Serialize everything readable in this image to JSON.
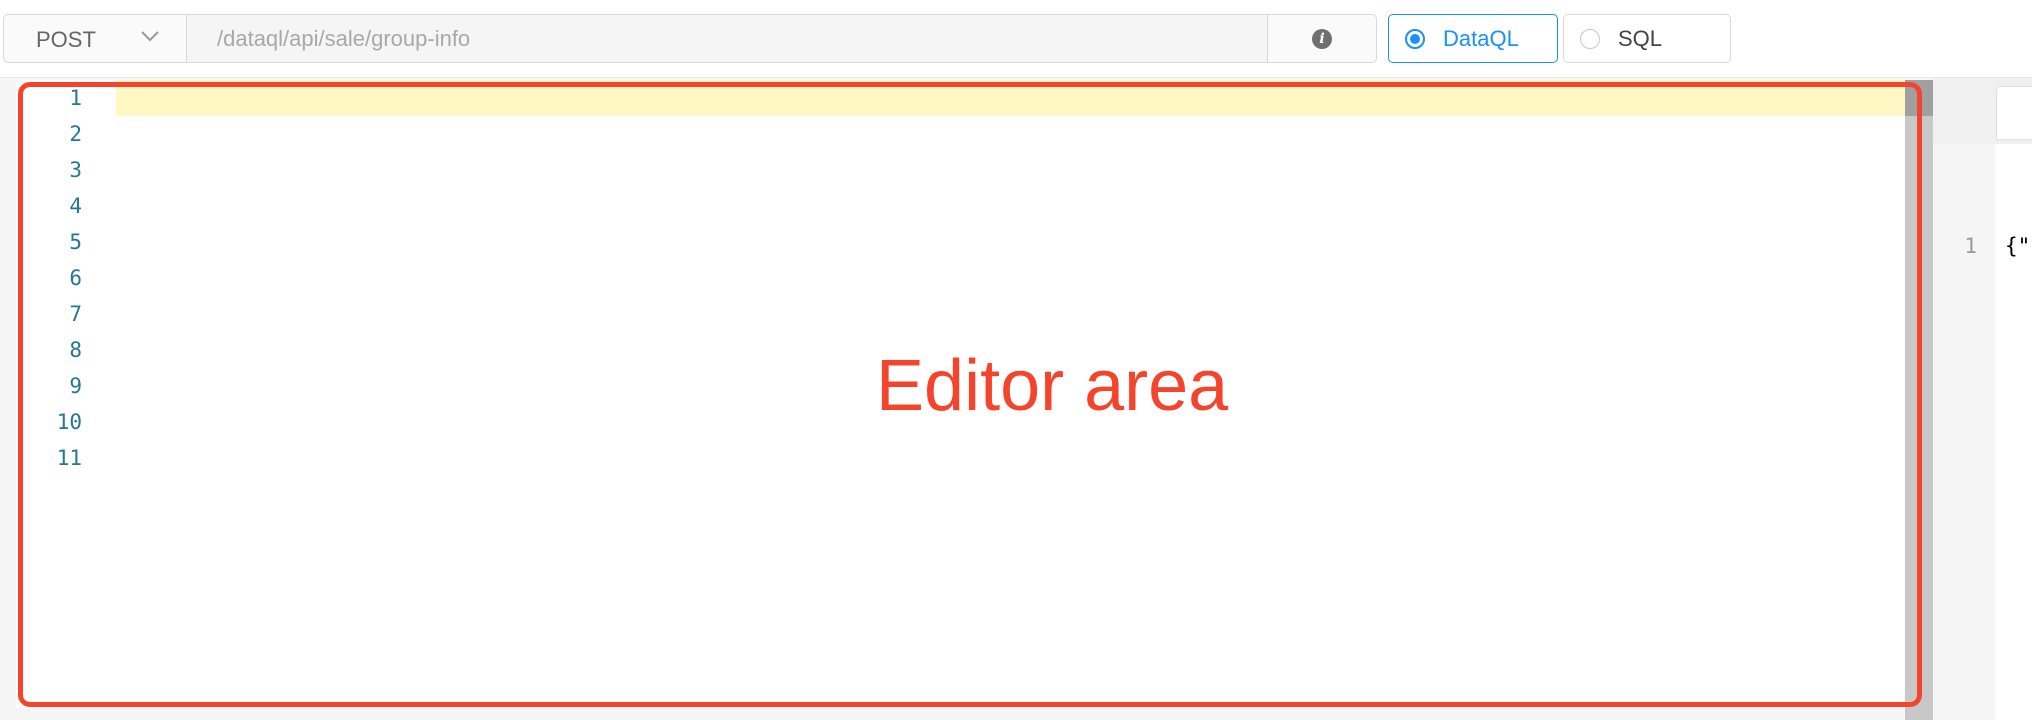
{
  "toolbar": {
    "method": "POST",
    "url_value": "/dataql/api/sale/group-info",
    "info_icon": "info-circle-icon",
    "modes": [
      {
        "label": "DataQL",
        "selected": true
      },
      {
        "label": "SQL",
        "selected": false
      }
    ]
  },
  "editor": {
    "line_numbers": [
      "1",
      "2",
      "3",
      "4",
      "5",
      "6",
      "7",
      "8",
      "9",
      "10",
      "11"
    ],
    "annotation_label": "Editor area"
  },
  "result": {
    "line_number": "1",
    "line_text": "{\""
  },
  "colors": {
    "accent": "#1890ff",
    "annotation": "#f4442b",
    "line_number": "#237893",
    "active_line": "#fff8c5"
  }
}
